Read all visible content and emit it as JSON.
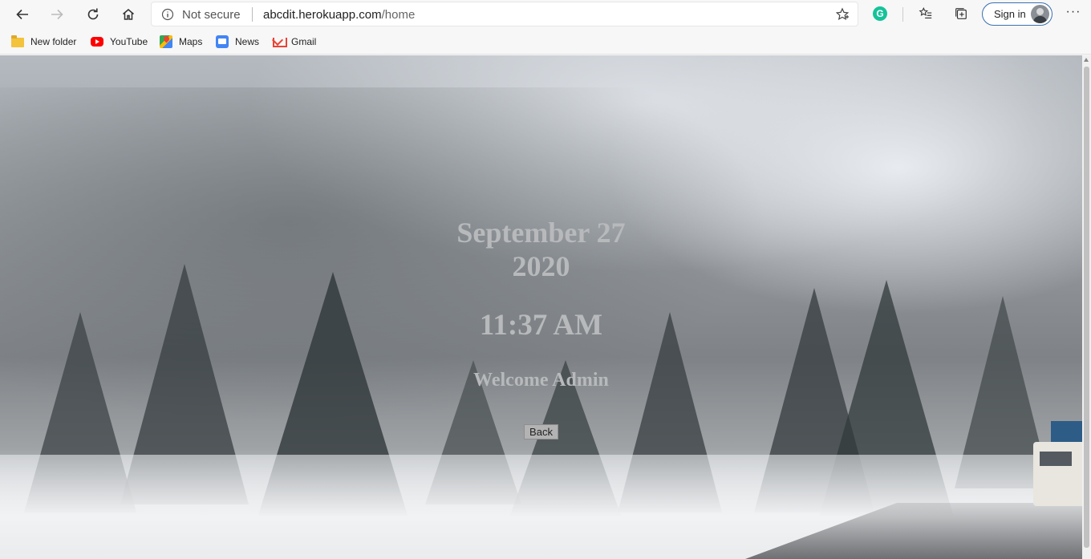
{
  "browser": {
    "security_label": "Not secure",
    "url_host": "abcdit.herokuapp.com",
    "url_path": "/home",
    "sign_in_label": "Sign in",
    "more_label": "···",
    "grammarly_letter": "G"
  },
  "bookmarks": [
    {
      "label": "New folder",
      "icon": "folder-icon"
    },
    {
      "label": "YouTube",
      "icon": "youtube-icon"
    },
    {
      "label": "Maps",
      "icon": "maps-icon"
    },
    {
      "label": "News",
      "icon": "news-icon"
    },
    {
      "label": "Gmail",
      "icon": "gmail-icon"
    }
  ],
  "page": {
    "date_line1": "September 27",
    "date_line2": "2020",
    "time": "11:37 AM",
    "welcome": "Welcome Admin",
    "back_label": "Back",
    "text_color": "#b7b9bb"
  }
}
